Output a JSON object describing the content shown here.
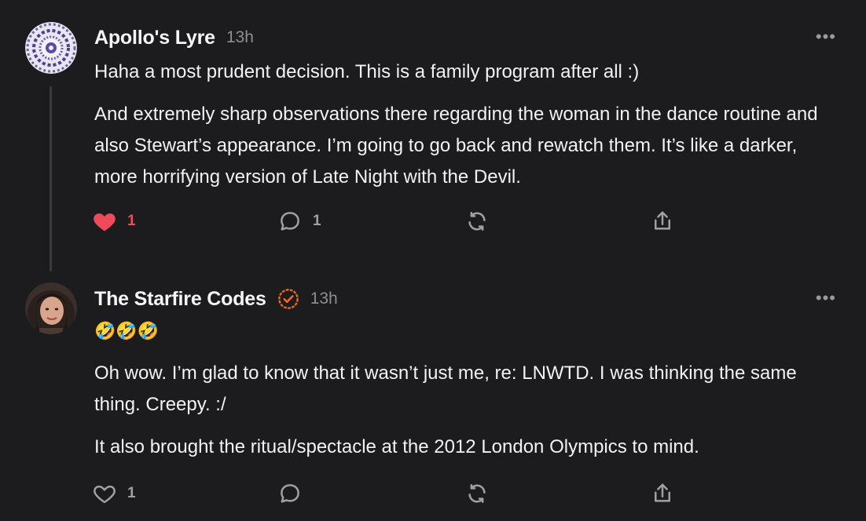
{
  "posts": [
    {
      "author": "Apollo's Lyre",
      "time": "13h",
      "verified": false,
      "paragraphs": [
        "Haha a most prudent decision. This is a family program after all :)",
        "And extremely sharp observations there regarding the woman in the dance routine and also Stewart’s appearance. I’m going to go back and rewatch them. It’s like a darker, more horrifying version of Late Night with the Devil."
      ],
      "likes": "1",
      "liked": true,
      "replies": "1"
    },
    {
      "author": "The Starfire Codes",
      "time": "13h",
      "verified": true,
      "paragraphs": [
        "🤣🤣🤣",
        "Oh wow. I’m glad to know that it wasn’t just me, re: LNWTD. I was thinking the same thing. Creepy. :/",
        "It also brought the ritual/spectacle at the 2012 London Olympics to mind."
      ],
      "likes": "1",
      "liked": false,
      "replies": ""
    }
  ],
  "icons": {
    "like": "heart-icon",
    "reply": "speech-bubble-icon",
    "repost": "repost-icon",
    "share": "share-icon",
    "more": "more-options-icon",
    "verified": "verified-badge-icon"
  },
  "colors": {
    "background": "#1c1c1e",
    "liked": "#ee4a5a",
    "verified": "#f36a1c"
  }
}
